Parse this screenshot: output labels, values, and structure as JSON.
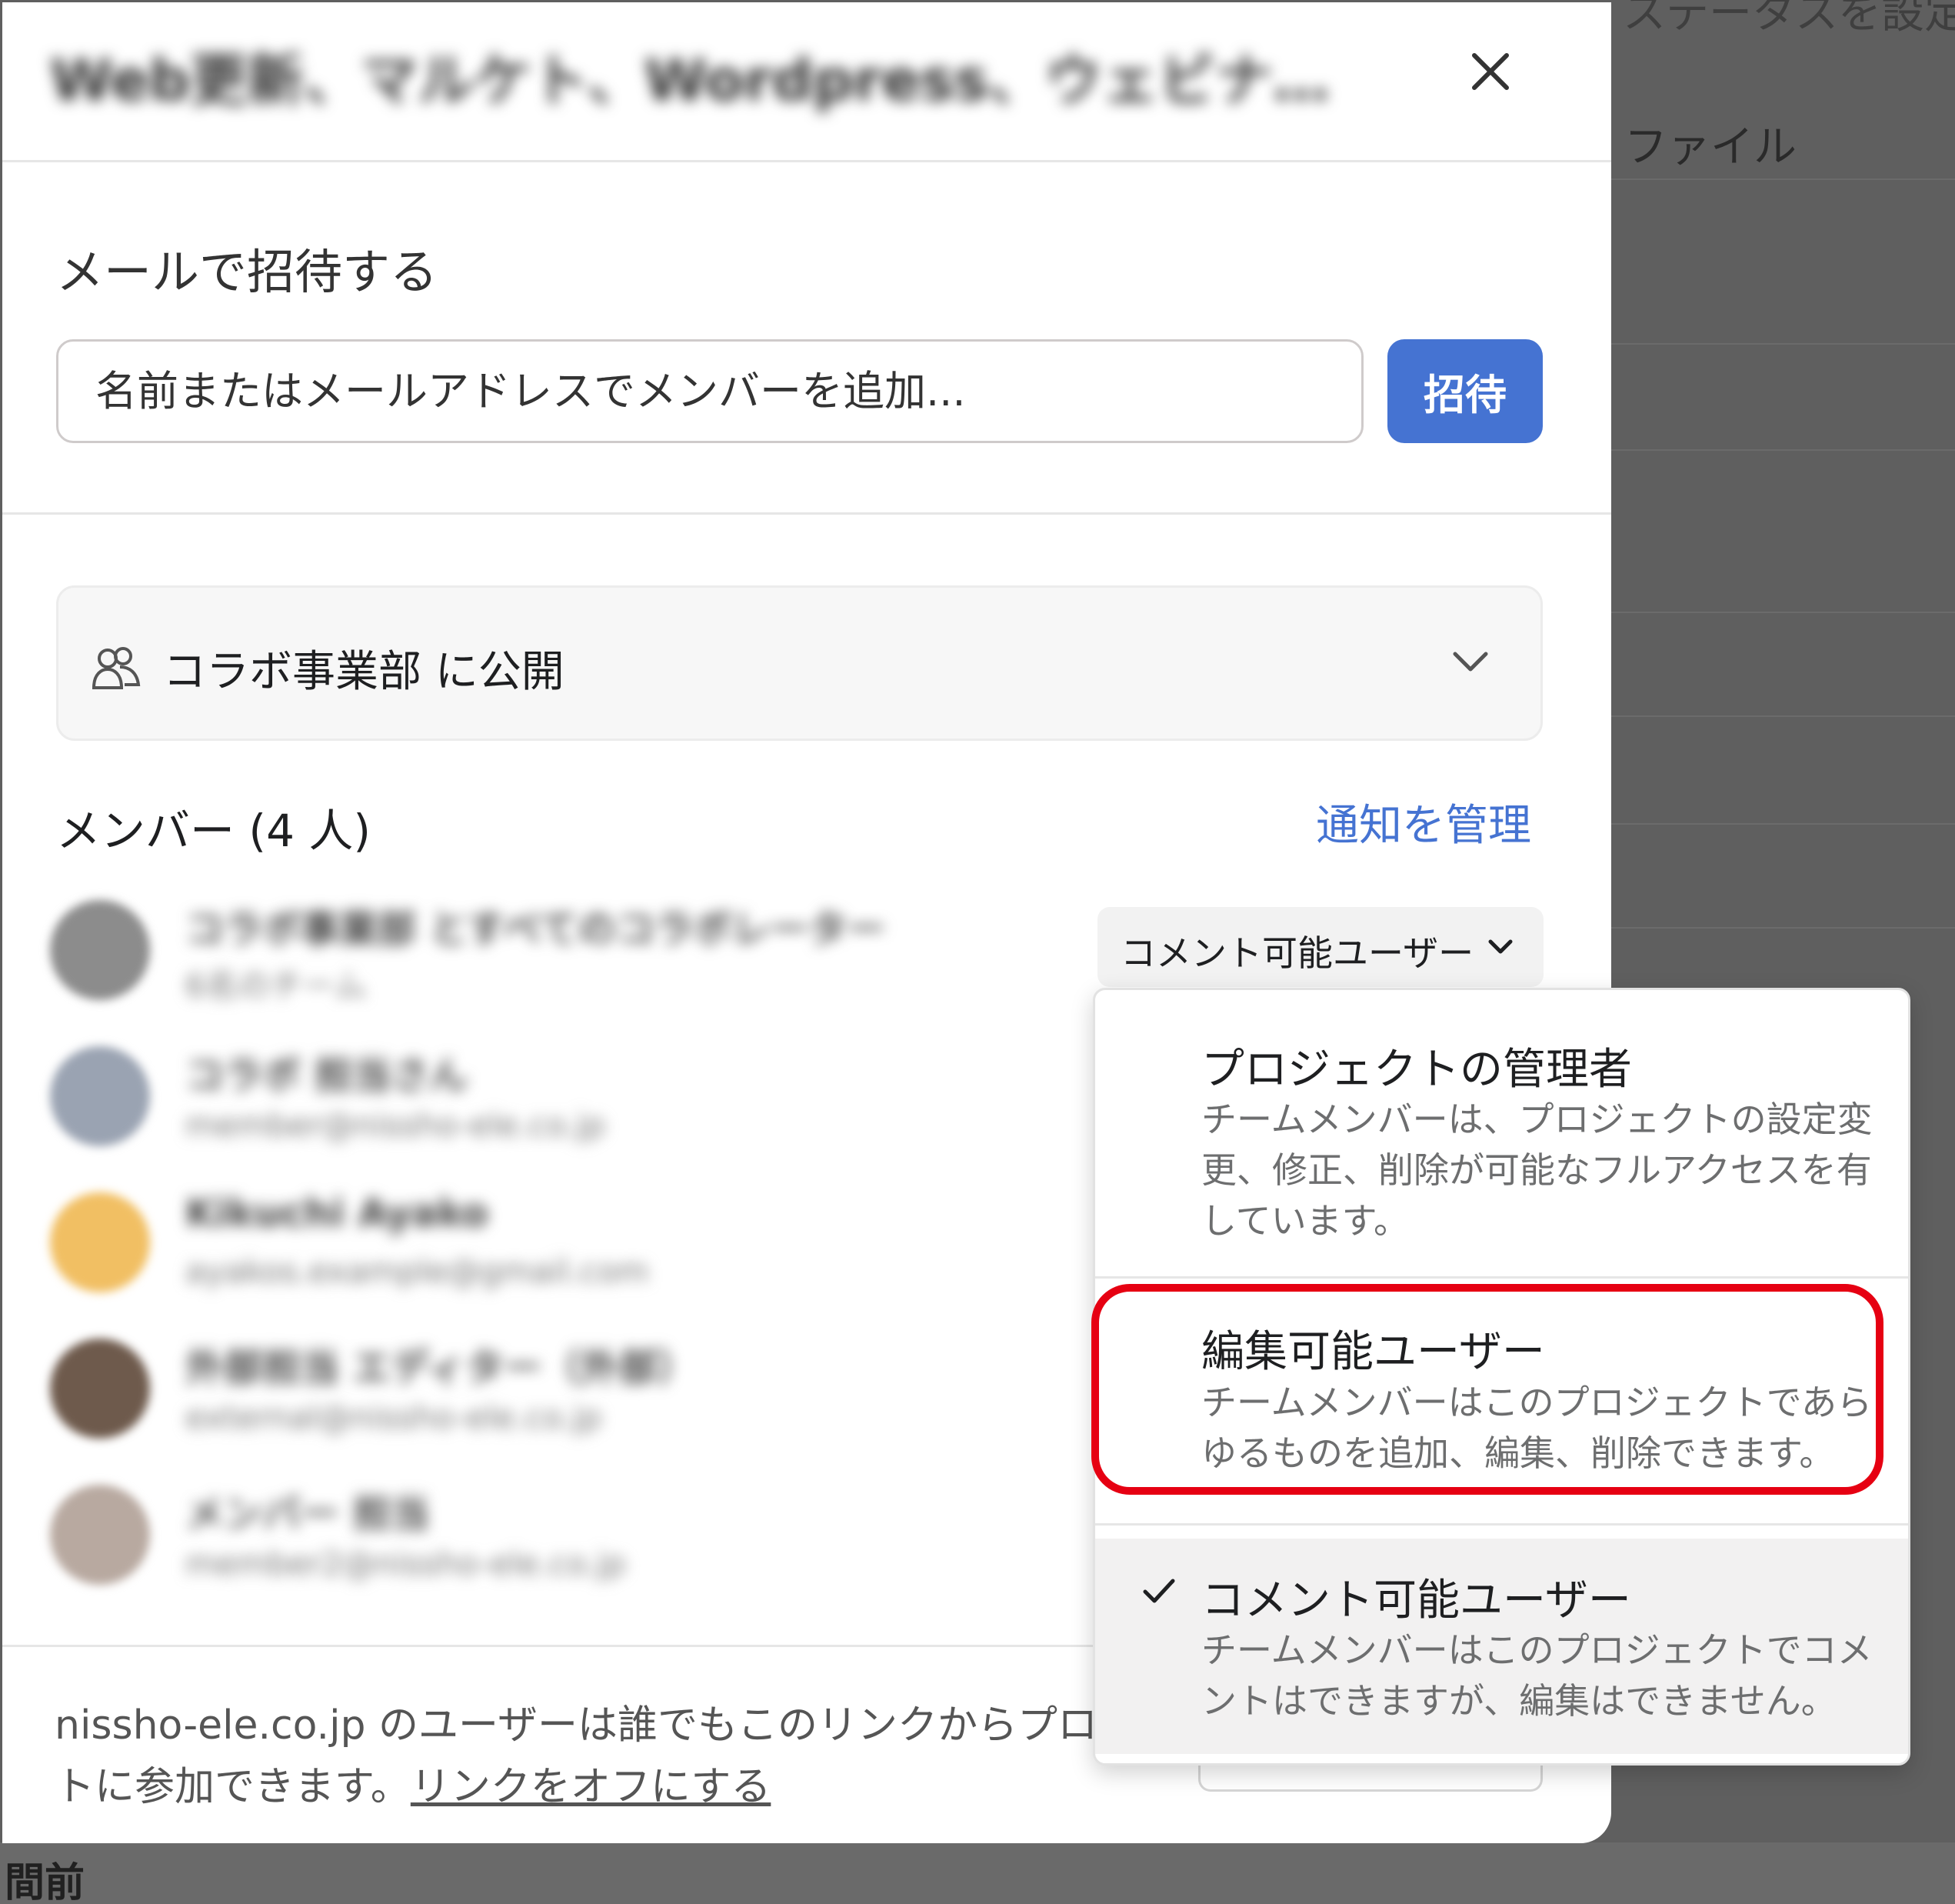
{
  "background": {
    "top_right_text": "ステータスを設定",
    "file_label": "ファイル",
    "bottom_left_text": "間前"
  },
  "dialog": {
    "title": "Web更新、マルケト、Wordpress、ウェビナー管理",
    "close_icon": "close-icon",
    "invite": {
      "label": "メールで招待する",
      "placeholder": "名前またはメールアドレスでメンバーを追加...",
      "button": "招待"
    },
    "visibility": {
      "icon": "team-icon",
      "label": "コラボ事業部 に公開",
      "chevron": "chevron-down-icon"
    },
    "members": {
      "heading": "メンバー (4 人)",
      "manage_notifications": "通知を管理",
      "list": [
        {
          "name": "コラボ事業部 とすべてのコラボレーター",
          "sub": "6名のチーム",
          "avatar_color": "#8c8c8c"
        },
        {
          "name": "コラボ 担当さん",
          "sub": "member@nissho-ele.co.jp",
          "avatar_color": "#9aa3b2"
        },
        {
          "name": "Kikuchi Ayako",
          "sub": "ayakos.example@gmail.com",
          "avatar_color": "#f1bf63"
        },
        {
          "name": "外部担当 エディター（外部）",
          "sub": "external@nissho-ele.co.jp",
          "avatar_color": "#6e5a4c"
        },
        {
          "name": "メンバー 担当",
          "sub": "member2@nissho-ele.co.jp",
          "avatar_color": "#b8a9a0"
        }
      ],
      "role_trigger": "コメント可能ユーザー"
    },
    "footer": {
      "text": "nissho-ele.co.jp のユーザーは誰でもこのリンクからプロジェクトに参加できます。",
      "link": "リンクをオフにする"
    }
  },
  "role_menu": {
    "items": [
      {
        "title": "プロジェクトの管理者",
        "description": "チームメンバーは、プロジェクトの設定変更、修正、削除が可能なフルアクセスを有しています。",
        "selected": false
      },
      {
        "title": "編集可能ユーザー",
        "description": "チームメンバーはこのプロジェクトであらゆるものを追加、編集、削除できます。",
        "selected": false
      },
      {
        "title": "コメント可能ユーザー",
        "description": "チームメンバーはこのプロジェクトでコメントはできますが、編集はできません。",
        "selected": true
      }
    ],
    "check_icon": "check-icon"
  },
  "annotation": {
    "highlight_color": "#e60012"
  },
  "colors": {
    "accent": "#4573d2",
    "overlay": "#5e5e5e"
  }
}
